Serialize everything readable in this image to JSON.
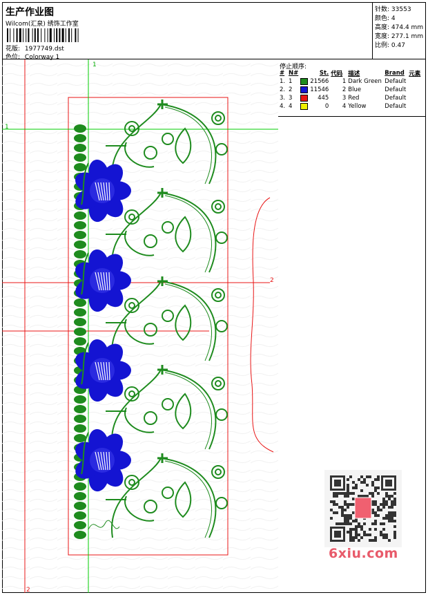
{
  "header": {
    "title": "生产作业图",
    "subtitle": "Wilcom(汇泉) 绣饰工作室",
    "design_label": "花版:",
    "design_value": "1977749.dst",
    "colorway_label": "色位:",
    "colorway_value": "Colorway 1"
  },
  "stats": [
    {
      "label": "针数:",
      "value": "33553"
    },
    {
      "label": "颜色:",
      "value": "4"
    },
    {
      "label": "高度:",
      "value": "474.4 mm"
    },
    {
      "label": "宽度:",
      "value": "277.1 mm"
    },
    {
      "label": "比例:",
      "value": "0.47"
    }
  ],
  "stop_sequence": {
    "title": "停止顺序:",
    "headers": [
      "#",
      "N#",
      "St.",
      "代码",
      "描述",
      "Brand",
      "元素"
    ],
    "rows": [
      {
        "idx": "1.",
        "n": "1",
        "color": "#1e8b1e",
        "stitches": "21566",
        "code": "1",
        "desc": "Dark Green",
        "brand": "Default"
      },
      {
        "idx": "2.",
        "n": "2",
        "color": "#1414d2",
        "stitches": "11546",
        "code": "2",
        "desc": "Blue",
        "brand": "Default"
      },
      {
        "idx": "3.",
        "n": "3",
        "color": "#e81414",
        "stitches": "445",
        "code": "3",
        "desc": "Red",
        "brand": "Default"
      },
      {
        "idx": "4.",
        "n": "4",
        "color": "#f0f000",
        "stitches": "0",
        "code": "4",
        "desc": "Yellow",
        "brand": "Default"
      }
    ]
  },
  "guides": {
    "marker_1": "1",
    "marker_2": "2"
  },
  "colors": {
    "dark_green": "#1e8b1e",
    "blue": "#1414d2",
    "red": "#e81414",
    "guide_green": "#00cc00"
  },
  "watermark": {
    "text": "6xiu.com"
  }
}
